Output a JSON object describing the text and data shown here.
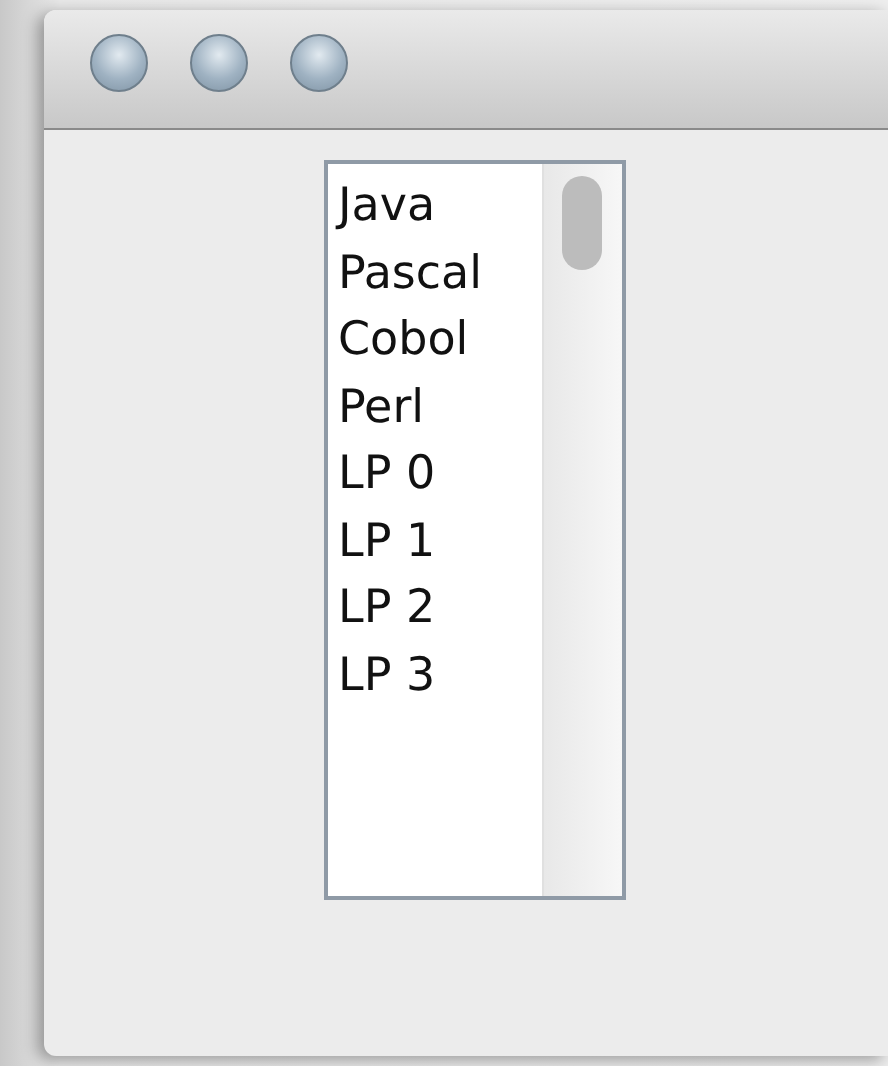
{
  "list": {
    "items": [
      "Java",
      "Pascal",
      "Cobol",
      "Perl",
      "LP 0",
      "LP 1",
      "LP 2",
      "LP 3"
    ]
  }
}
